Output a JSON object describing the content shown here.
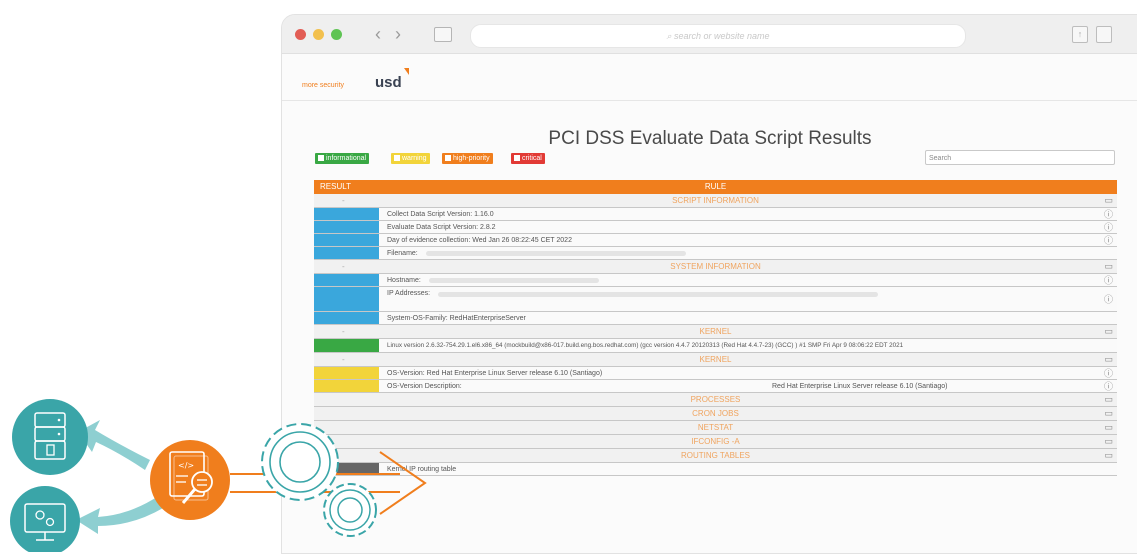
{
  "browser": {
    "url_placeholder": "search or website name",
    "back_glyph": "‹",
    "forward_glyph": "›"
  },
  "brand": {
    "tagline": "more security",
    "name": "usd"
  },
  "report": {
    "title": "PCI DSS Evaluate Data Script Results",
    "filters": [
      {
        "label": "informational",
        "color": "#39a844"
      },
      {
        "label": "warning",
        "color": "#f2d43a"
      },
      {
        "label": "high-priority",
        "color": "#f07e1d"
      },
      {
        "label": "critical",
        "color": "#e23a35"
      }
    ],
    "search_placeholder": "Search",
    "headers": {
      "result": "RESULT",
      "rule": "RULE"
    },
    "sections": {
      "script_information": "SCRIPT INFORMATION",
      "system_information": "SYSTEM INFORMATION",
      "kernel_1": "KERNEL",
      "kernel_2": "KERNEL",
      "processes": "PROCESSES",
      "cron_jobs": "CRON JOBS",
      "netstat": "NETSTAT",
      "ifconfig": "IFCONFIG -A",
      "routing_tables": "ROUTING TABLES"
    },
    "dash": "-",
    "rows": {
      "collect_version": "Collect Data Script Version: 1.16.0",
      "evaluate_version": "Evaluate Data Script Version: 2.8.2",
      "day_of_evidence": "Day of evidence collection: Wed Jan 26 08:22:45 CET 2022",
      "filename": "Filename:",
      "hostname": "Hostname:",
      "ip_addresses": "IP Addresses:",
      "os_family": "System-OS-Family: RedHatEnterpriseServer",
      "linux_version": "Linux version 2.6.32-754.29.1.el6.x86_64 (mockbuild@x86-017.build.eng.bos.redhat.com) (gcc version 4.4.7 20120313 (Red Hat 4.4.7-23) (GCC) ) #1 SMP Fri Apr 9 08:06:22 EDT 2021",
      "os_version": "OS-Version: Red Hat Enterprise Linux Server release 6.10 (Santiago)",
      "os_version_desc_label": "OS-Version Description:",
      "os_version_desc_value": "Red Hat Enterprise Linux Server release 6.10 (Santiago)",
      "kernel_routing": "Kernel IP routing table"
    },
    "result_colors": {
      "info": "#3aa7dc",
      "ok": "#39a844",
      "warning": "#f2d43a",
      "neutral": "#666666"
    }
  },
  "illustration": {
    "accent": "#f07e1d",
    "teal": "#3aa5a8",
    "code_glyph": "</>"
  }
}
